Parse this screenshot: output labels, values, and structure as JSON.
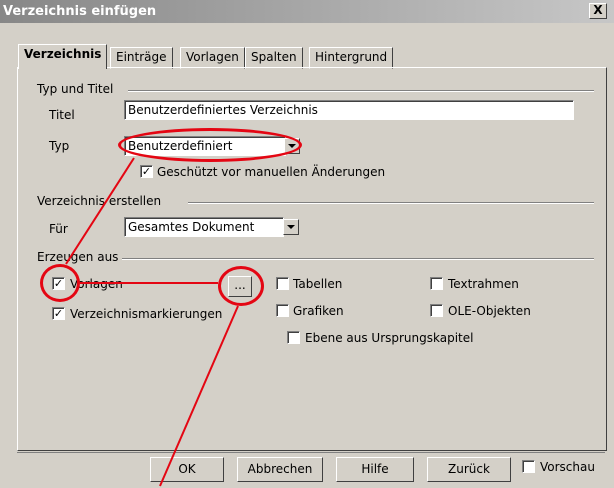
{
  "window": {
    "title": "Verzeichnis einfügen",
    "close_label": "X"
  },
  "tabs": [
    {
      "label": "Verzeichnis"
    },
    {
      "label": "Einträge"
    },
    {
      "label": "Vorlagen"
    },
    {
      "label": "Spalten"
    },
    {
      "label": "Hintergrund"
    }
  ],
  "typ_und_titel": {
    "group_label": "Typ und Titel",
    "titel_label": "Titel",
    "titel_value": "Benutzerdefiniertes Verzeichnis",
    "typ_label": "Typ",
    "typ_value": "Benutzerdefiniert",
    "geschuetzt_label": "Geschützt vor manuellen Änderungen",
    "geschuetzt_checked": true
  },
  "verzeichnis_erstellen": {
    "group_label": "Verzeichnis erstellen",
    "fuer_label": "Für",
    "fuer_value": "Gesamtes Dokument"
  },
  "erzeugen_aus": {
    "group_label": "Erzeugen aus",
    "vorlagen_label": "Vorlagen",
    "vorlagen_checked": true,
    "ellipsis_label": "...",
    "markierungen_label": "Verzeichnismarkierungen",
    "markierungen_checked": true,
    "tabellen_label": "Tabellen",
    "textrahmen_label": "Textrahmen",
    "grafiken_label": "Grafiken",
    "ole_label": "OLE-Objekten",
    "ebene_label": "Ebene aus Ursprungskapitel"
  },
  "footer": {
    "ok_label": "OK",
    "abbrechen_label": "Abbrechen",
    "hilfe_label": "Hilfe",
    "zurueck_label": "Zurück",
    "vorschau_label": "Vorschau"
  },
  "annotation_color": "#e40613"
}
